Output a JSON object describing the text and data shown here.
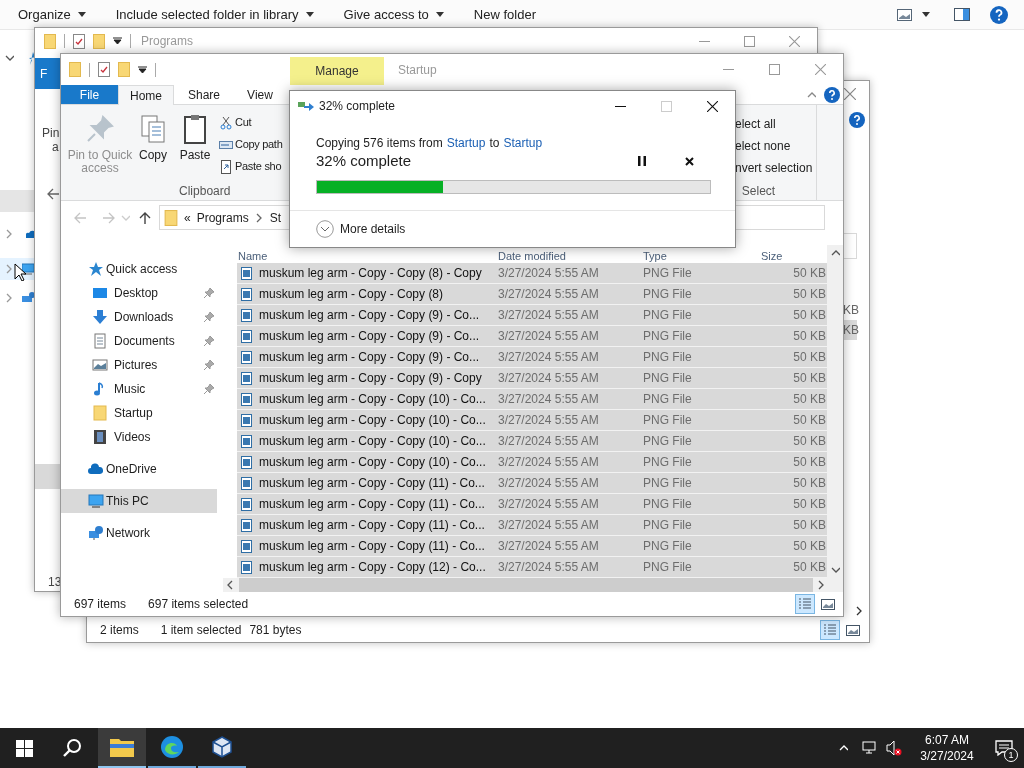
{
  "background_window": {
    "toolbar": [
      {
        "label": "Organize",
        "dropdown": true
      },
      {
        "label": "Include selected folder in library",
        "dropdown": true
      },
      {
        "label": "Give access to",
        "dropdown": true
      },
      {
        "label": "New folder",
        "dropdown": false
      }
    ]
  },
  "window_programs": {
    "title": "Programs",
    "file_tab": "F",
    "ribbon_fragments": [
      "Pin",
      "a"
    ],
    "status": "13"
  },
  "window_behind": {
    "size_fragments": [
      {
        "text": "KB",
        "selected": false
      },
      {
        "text": "KB",
        "selected": true
      }
    ],
    "status": {
      "count": "2 items",
      "selected": "1 item selected",
      "size": "781 bytes"
    },
    "views": [
      {
        "kind": "details",
        "selected": true
      },
      {
        "kind": "large",
        "selected": false
      }
    ]
  },
  "explorer": {
    "title": "Startup",
    "context_tab": "Manage",
    "tabs": [
      {
        "label": "File",
        "kind": "file",
        "selected": false
      },
      {
        "label": "Home",
        "kind": "tab",
        "selected": true
      },
      {
        "label": "Share",
        "kind": "tab",
        "selected": false
      },
      {
        "label": "View",
        "kind": "tab",
        "selected": false
      }
    ],
    "clipboard": {
      "label": "Clipboard",
      "large": [
        {
          "label": "Pin to Quick access",
          "kind": "pin",
          "disabled": true
        },
        {
          "label": "Copy",
          "kind": "copy",
          "disabled": false
        },
        {
          "label": "Paste",
          "kind": "paste",
          "disabled": false
        }
      ],
      "small": [
        {
          "label": "Cut",
          "kind": "cut"
        },
        {
          "label": "Copy path",
          "kind": "path"
        },
        {
          "label": "Paste sho",
          "kind": "shortcut"
        }
      ]
    },
    "select": {
      "label": "Select",
      "items": [
        "elect all",
        "elect none",
        "nvert selection"
      ]
    },
    "address": {
      "overflow": "«",
      "parts": [
        "Programs",
        "St"
      ]
    },
    "nav": [
      {
        "label": "Quick access",
        "kind": "star",
        "selected": false,
        "children": [
          {
            "label": "Desktop",
            "kind": "desktop",
            "pinned": true,
            "selected": false
          },
          {
            "label": "Downloads",
            "kind": "download",
            "pinned": true,
            "selected": false
          },
          {
            "label": "Documents",
            "kind": "document",
            "pinned": true,
            "selected": false
          },
          {
            "label": "Pictures",
            "kind": "picture",
            "pinned": true,
            "selected": false
          },
          {
            "label": "Music",
            "kind": "music",
            "pinned": true,
            "selected": false
          },
          {
            "label": "Startup",
            "kind": "folder",
            "pinned": false,
            "selected": false
          },
          {
            "label": "Videos",
            "kind": "video",
            "pinned": false,
            "selected": false
          }
        ]
      },
      {
        "label": "OneDrive",
        "kind": "cloud",
        "selected": false
      },
      {
        "label": "This PC",
        "kind": "pc",
        "selected": true
      },
      {
        "label": "Network",
        "kind": "network",
        "selected": false
      }
    ],
    "columns": [
      "Name",
      "Date modified",
      "Type",
      "Size"
    ],
    "rows": [
      {
        "name": "muskum leg arm - Copy - Copy (8) - Copy",
        "date": "3/27/2024 5:55 AM",
        "type": "PNG File",
        "size": "50 KB",
        "selected": true
      },
      {
        "name": "muskum leg arm - Copy - Copy (8)",
        "date": "3/27/2024 5:55 AM",
        "type": "PNG File",
        "size": "50 KB",
        "selected": true
      },
      {
        "name": "muskum leg arm - Copy - Copy (9) - Co...",
        "date": "3/27/2024 5:55 AM",
        "type": "PNG File",
        "size": "50 KB",
        "selected": true
      },
      {
        "name": "muskum leg arm - Copy - Copy (9) - Co...",
        "date": "3/27/2024 5:55 AM",
        "type": "PNG File",
        "size": "50 KB",
        "selected": true
      },
      {
        "name": "muskum leg arm - Copy - Copy (9) - Co...",
        "date": "3/27/2024 5:55 AM",
        "type": "PNG File",
        "size": "50 KB",
        "selected": true
      },
      {
        "name": "muskum leg arm - Copy - Copy (9) - Copy",
        "date": "3/27/2024 5:55 AM",
        "type": "PNG File",
        "size": "50 KB",
        "selected": true
      },
      {
        "name": "muskum leg arm - Copy - Copy (10) - Co...",
        "date": "3/27/2024 5:55 AM",
        "type": "PNG File",
        "size": "50 KB",
        "selected": true
      },
      {
        "name": "muskum leg arm - Copy - Copy (10) - Co...",
        "date": "3/27/2024 5:55 AM",
        "type": "PNG File",
        "size": "50 KB",
        "selected": true
      },
      {
        "name": "muskum leg arm - Copy - Copy (10) - Co...",
        "date": "3/27/2024 5:55 AM",
        "type": "PNG File",
        "size": "50 KB",
        "selected": true
      },
      {
        "name": "muskum leg arm - Copy - Copy (10) - Co...",
        "date": "3/27/2024 5:55 AM",
        "type": "PNG File",
        "size": "50 KB",
        "selected": true
      },
      {
        "name": "muskum leg arm - Copy - Copy (11) - Co...",
        "date": "3/27/2024 5:55 AM",
        "type": "PNG File",
        "size": "50 KB",
        "selected": true
      },
      {
        "name": "muskum leg arm - Copy - Copy (11) - Co...",
        "date": "3/27/2024 5:55 AM",
        "type": "PNG File",
        "size": "50 KB",
        "selected": true
      },
      {
        "name": "muskum leg arm - Copy - Copy (11) - Co...",
        "date": "3/27/2024 5:55 AM",
        "type": "PNG File",
        "size": "50 KB",
        "selected": true
      },
      {
        "name": "muskum leg arm - Copy - Copy (11) - Co...",
        "date": "3/27/2024 5:55 AM",
        "type": "PNG File",
        "size": "50 KB",
        "selected": true
      },
      {
        "name": "muskum leg arm - Copy - Copy (12) - Co...",
        "date": "3/27/2024 5:55 AM",
        "type": "PNG File",
        "size": "50 KB",
        "selected": true
      }
    ],
    "status": {
      "count": "697 items",
      "selected": "697 items selected"
    },
    "views": [
      {
        "kind": "details",
        "selected": true
      },
      {
        "kind": "large",
        "selected": false
      }
    ]
  },
  "copy_dialog": {
    "title": "32% complete",
    "message": {
      "prefix": "Copying 576 items from",
      "source": "Startup",
      "middle": "to",
      "destination": "Startup"
    },
    "status": "32% complete",
    "level": 0.32,
    "details": "More details",
    "maximize_disabled": true
  },
  "taskbar": {
    "apps": [
      {
        "kind": "explorer",
        "selected": true
      },
      {
        "kind": "edge",
        "selected": false
      },
      {
        "kind": "virtualbox",
        "selected": false
      }
    ],
    "time": "6:07 AM",
    "date": "3/27/2024",
    "notifications": "1"
  }
}
